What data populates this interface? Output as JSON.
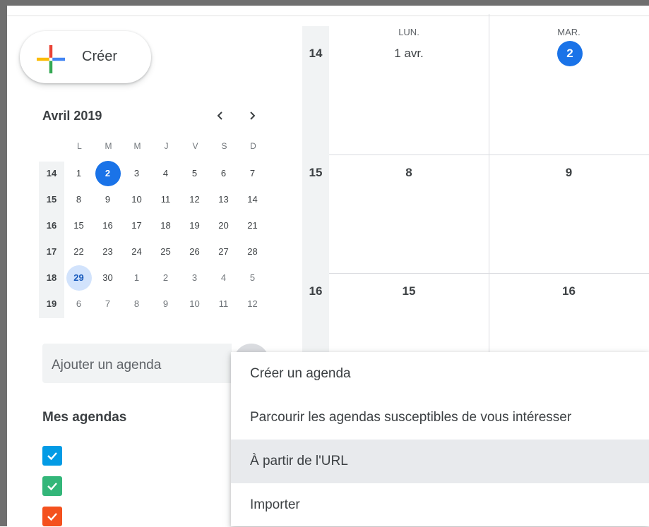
{
  "create_button": {
    "label": "Créer"
  },
  "mini_calendar": {
    "title": "Avril 2019",
    "prev_icon": "chevron-left-icon",
    "next_icon": "chevron-right-icon",
    "day_headers": [
      "L",
      "M",
      "M",
      "J",
      "V",
      "S",
      "D"
    ],
    "weeks": [
      {
        "week": "14",
        "days": [
          "1",
          "2",
          "3",
          "4",
          "5",
          "6",
          "7"
        ]
      },
      {
        "week": "15",
        "days": [
          "8",
          "9",
          "10",
          "11",
          "12",
          "13",
          "14"
        ]
      },
      {
        "week": "16",
        "days": [
          "15",
          "16",
          "17",
          "18",
          "19",
          "20",
          "21"
        ]
      },
      {
        "week": "17",
        "days": [
          "22",
          "23",
          "24",
          "25",
          "26",
          "27",
          "28"
        ]
      },
      {
        "week": "18",
        "days": [
          "29",
          "30",
          "1",
          "2",
          "3",
          "4",
          "5"
        ]
      },
      {
        "week": "19",
        "days": [
          "6",
          "7",
          "8",
          "9",
          "10",
          "11",
          "12"
        ]
      }
    ],
    "today": "2",
    "selected": "29"
  },
  "add_calendar": {
    "placeholder": "Ajouter un agenda"
  },
  "my_calendars": {
    "heading": "Mes agendas",
    "checkbox_colors": [
      "#039be5",
      "#33b679",
      "#f4511e"
    ]
  },
  "grid": {
    "columns": [
      {
        "weekday": "LUN.",
        "date": "1 avr."
      },
      {
        "weekday": "MAR.",
        "date": "2"
      }
    ],
    "rows": [
      {
        "week": "14",
        "cells": [
          "",
          ""
        ]
      },
      {
        "week": "15",
        "cells": [
          "8",
          "9"
        ]
      },
      {
        "week": "16",
        "cells": [
          "15",
          "16"
        ]
      }
    ]
  },
  "menu": {
    "items": [
      "Créer un agenda",
      "Parcourir les agendas susceptibles de vous intéresser",
      "À partir de l'URL",
      "Importer"
    ],
    "highlighted_index": 2
  },
  "colors": {
    "accent": "#1a73e8",
    "today_bg": "#1a73e8",
    "selected_bg": "#d2e3fc"
  }
}
